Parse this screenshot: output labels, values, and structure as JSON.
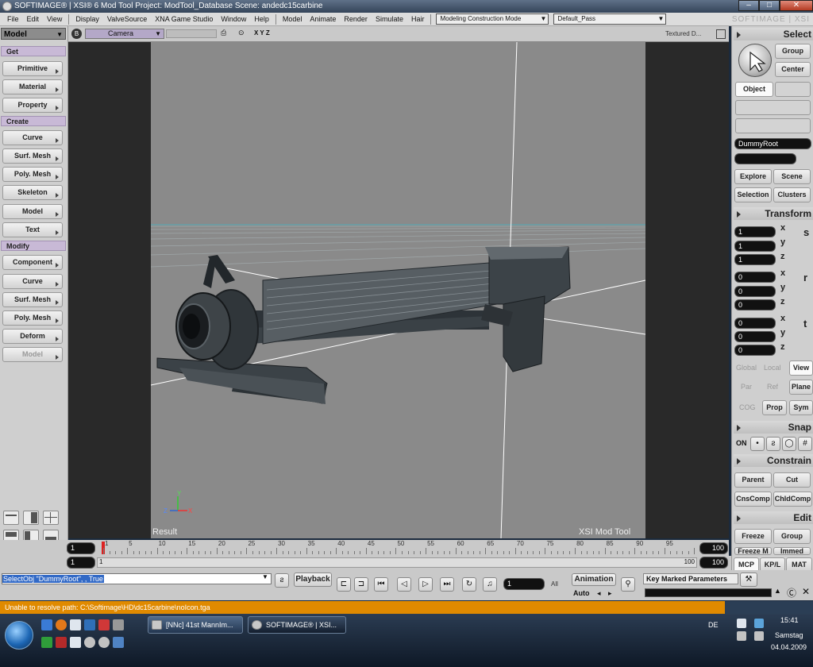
{
  "window": {
    "title": "SOFTIMAGE® | XSI® 6 Mod Tool Project: ModTool_Database    Scene: andedc15carbine",
    "brand": "SOFTIMAGE | XSI"
  },
  "menubar": {
    "items": [
      "File",
      "Edit",
      "View",
      "Display",
      "ValveSource",
      "XNA Game Studio",
      "Window",
      "Help",
      "Model",
      "Animate",
      "Render",
      "Simulate",
      "Hair"
    ],
    "mode": "Modeling Construction Mode",
    "pass": "Default_Pass"
  },
  "left_panel": {
    "module": "Model",
    "sections": [
      {
        "header": "Get",
        "buttons": [
          "Primitive",
          "Material",
          "Property"
        ]
      },
      {
        "header": "Create",
        "buttons": [
          "Curve",
          "Surf. Mesh",
          "Poly. Mesh",
          "Skeleton",
          "Model",
          "Text"
        ]
      },
      {
        "header": "Modify",
        "buttons": [
          "Component",
          "Curve",
          "Surf. Mesh",
          "Poly. Mesh",
          "Deform",
          "Model"
        ]
      }
    ]
  },
  "viewport": {
    "view_badge": "B",
    "camera": "Camera",
    "axes": "X Y Z",
    "shading": "Textured D...",
    "result_label": "Result",
    "watermark": "XSI Mod Tool",
    "gizmo": {
      "x": "X",
      "y": "Y",
      "z": "Z"
    }
  },
  "right_panel": {
    "select_header": "Select",
    "group": "Group",
    "center": "Center",
    "object": "Object",
    "selection_name": "DummyRoot",
    "explore": "Explore",
    "scene": "Scene",
    "selection": "Selection",
    "clusters": "Clusters",
    "transform_header": "Transform",
    "scale": [
      "1",
      "1",
      "1"
    ],
    "rotate": [
      "0",
      "0",
      "0"
    ],
    "translate": [
      "0",
      "0",
      "0"
    ],
    "axis_labels": [
      "x",
      "y",
      "z"
    ],
    "srt": [
      "s",
      "r",
      "t"
    ],
    "global": "Global",
    "local": "Local",
    "view": "View",
    "par": "Par",
    "ref": "Ref",
    "plane": "Plane",
    "cog": "COG",
    "prop": "Prop",
    "sym": "Sym",
    "snap_header": "Snap",
    "snap_on": "ON",
    "constrain_header": "Constrain",
    "parent": "Parent",
    "cut": "Cut",
    "cnscomp": "CnsComp",
    "chldcomp": "ChldComp",
    "edit_header": "Edit",
    "freeze": "Freeze",
    "edit_group": "Group",
    "freeze_m": "Freeze M",
    "immed": "Immed",
    "tabs": [
      "MCP",
      "KP/L",
      "MAT"
    ]
  },
  "timeline": {
    "start": "1",
    "end": "100",
    "range_start": "1",
    "range_mid": "1",
    "range_end": "100",
    "range_end2": "100",
    "ticks": [
      "1",
      "5",
      "10",
      "15",
      "20",
      "25",
      "30",
      "35",
      "40",
      "45",
      "50",
      "55",
      "60",
      "65",
      "70",
      "75",
      "80",
      "85",
      "90",
      "95"
    ]
  },
  "command": {
    "text": "SelectObj \"DummyRoot\", , True",
    "playback": "Playback",
    "frame": "1",
    "all": "All",
    "animation": "Animation",
    "auto": "Auto",
    "key_marked": "Key Marked Parameters"
  },
  "status": {
    "message": "Unable to resolve path: C:\\Softimage\\HD\\dc15carbine\\noIcon.tga"
  },
  "taskbar": {
    "tasks": [
      "[NNc] 41st MannIm...",
      "SOFTIMAGE® | XSI..."
    ],
    "lang": "DE",
    "time": "15:41",
    "day": "Samstag",
    "date": "04.04.2009"
  }
}
